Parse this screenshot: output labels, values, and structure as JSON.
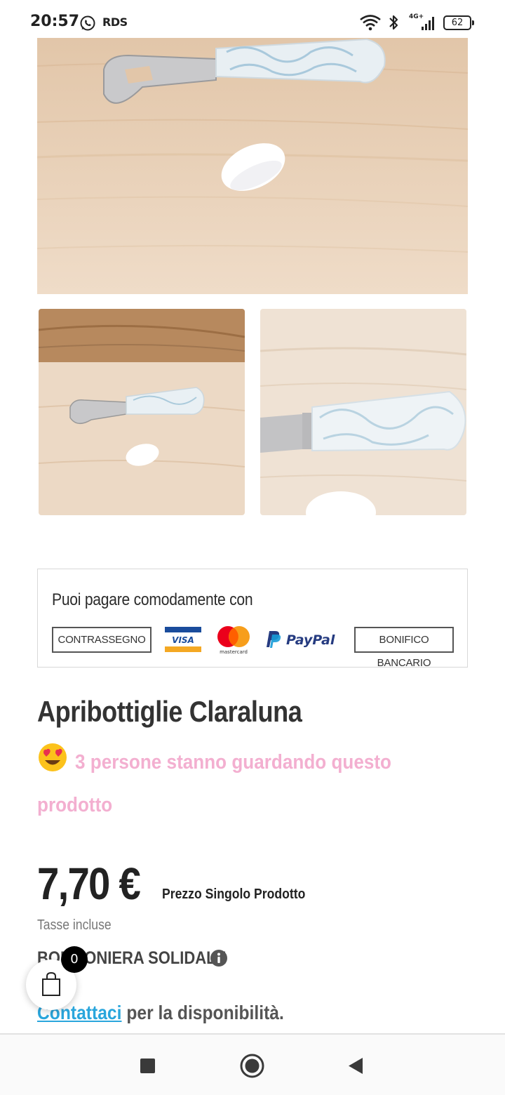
{
  "status_bar": {
    "time": "20:57",
    "carrier": "RDS",
    "network": "4G+",
    "battery": "62",
    "icons": [
      "whatsapp-icon",
      "wifi-icon",
      "bluetooth-icon",
      "signal-icon",
      "battery-icon"
    ]
  },
  "gallery": {
    "main_image": "product-photo-bottle-opener",
    "thumbnails": [
      "product-thumbnail-1",
      "product-thumbnail-2"
    ]
  },
  "payment": {
    "title": "Puoi pagare comodamente con",
    "cod": "CONTRASSEGNO",
    "visa": "VISA",
    "mastercard": "mastercard",
    "paypal": "PayPal",
    "bank_transfer": "BONIFICO BANCARIO"
  },
  "product": {
    "title": "Apribottiglie Claraluna",
    "viewers": "3 persone stanno guardando questo prodotto",
    "price": "7,70 €",
    "price_note": "Prezzo Singolo Prodotto",
    "tax_note": "Tasse incluse",
    "solidale": "BOMBONIERA SOLIDALE",
    "contact_link": "Contattaci",
    "availability_suffix": " per la disponibilità."
  },
  "cart": {
    "count": "0"
  },
  "colors": {
    "viewers_pink": "#f3afd0",
    "link_blue": "#2aa6dc",
    "wood": "#e9cfb4"
  }
}
